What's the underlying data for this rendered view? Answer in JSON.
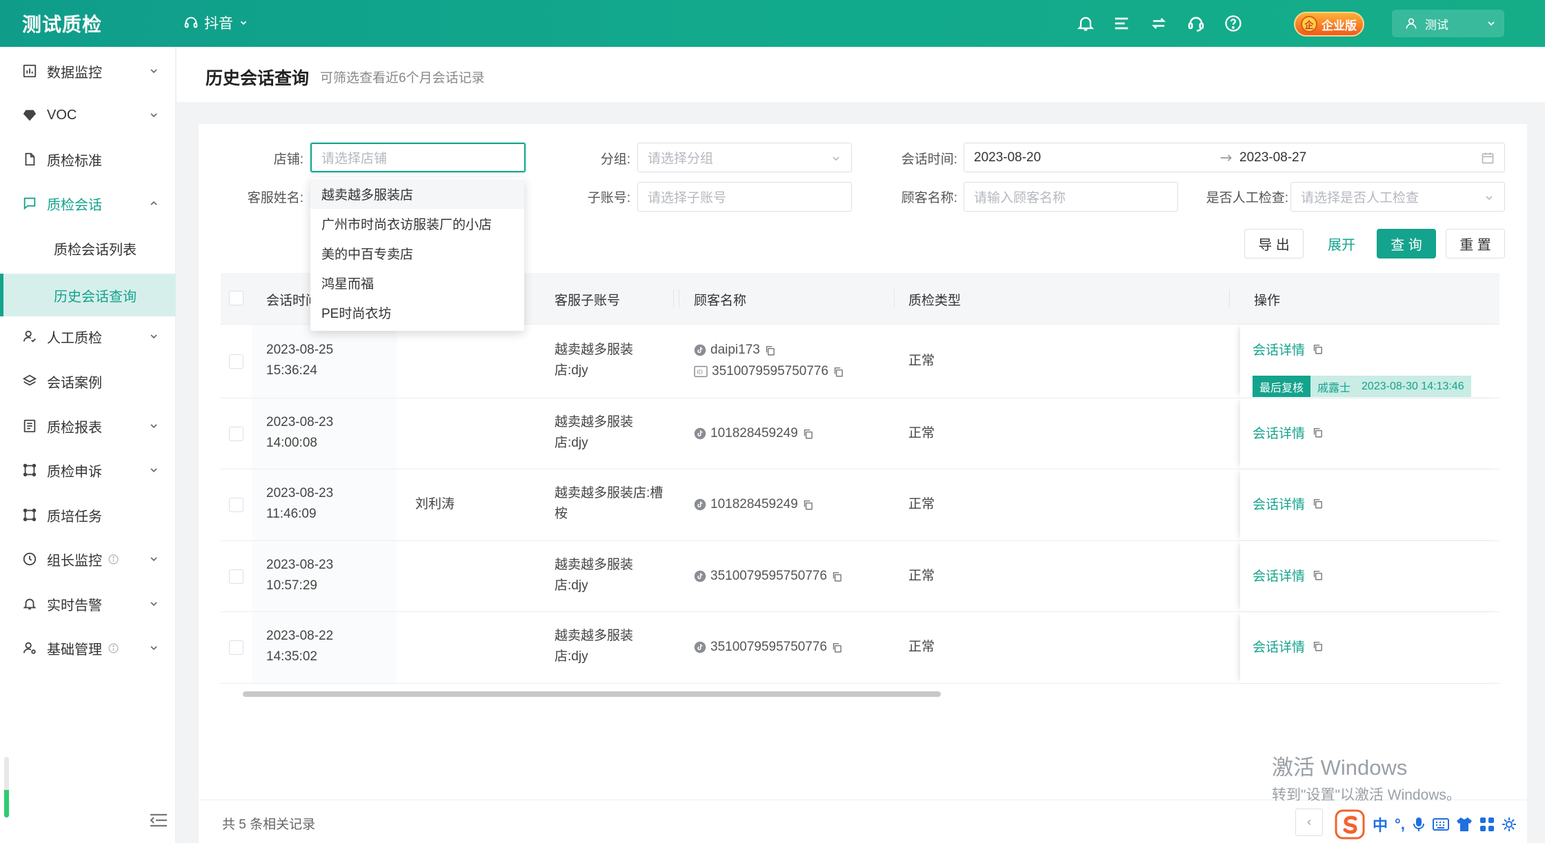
{
  "app": {
    "title": "测试质检",
    "platform": "抖音",
    "edition": "企业版",
    "edition_badge": "企",
    "user": "测试"
  },
  "sidebar": {
    "items": [
      {
        "label": "数据监控",
        "icon": "chart-bar-icon"
      },
      {
        "label": "VOC",
        "icon": "diamond-icon"
      },
      {
        "label": "质检标准",
        "icon": "document-icon"
      },
      {
        "label": "质检会话",
        "icon": "chat-icon"
      },
      {
        "label": "人工质检",
        "icon": "user-check-icon"
      },
      {
        "label": "会话案例",
        "icon": "layers-icon"
      },
      {
        "label": "质检报表",
        "icon": "report-icon"
      },
      {
        "label": "质检申诉",
        "icon": "appeal-icon"
      },
      {
        "label": "质培任务",
        "icon": "task-icon"
      },
      {
        "label": "组长监控",
        "icon": "clock-icon"
      },
      {
        "label": "实时告警",
        "icon": "bell-icon"
      },
      {
        "label": "基础管理",
        "icon": "user-settings-icon"
      }
    ],
    "subitems": [
      "质检会话列表",
      "历史会话查询"
    ],
    "progress_percent": 45
  },
  "page": {
    "title": "历史会话查询",
    "subtitle": "可筛选查看近6个月会话记录"
  },
  "filters": {
    "shop_label": "店铺:",
    "shop_placeholder": "请选择店铺",
    "group_label": "分组:",
    "group_placeholder": "请选择分组",
    "time_label": "会话时间:",
    "time_start": "2023-08-20",
    "time_end": "2023-08-27",
    "agent_label": "客服姓名:",
    "subaccount_label": "子账号:",
    "subaccount_placeholder": "请选择子账号",
    "customer_label": "顾客名称:",
    "customer_placeholder": "请输入顾客名称",
    "manual_label": "是否人工检查:",
    "manual_placeholder": "请选择是否人工检查"
  },
  "buttons": {
    "export": "导 出",
    "expand": "展开",
    "search": "查 询",
    "reset": "重 置"
  },
  "shop_dropdown": [
    "越卖越多服装店",
    "广州市时尚衣访服装厂的小店",
    "美的中百专卖店",
    "鸿星而福",
    "PE时尚衣坊"
  ],
  "table": {
    "columns": [
      "会话时间",
      "客服子账号",
      "顾客名称",
      "质检类型",
      "操作"
    ],
    "rows": [
      {
        "date": "2023-08-25",
        "time": "15:36:24",
        "agent": "",
        "sub1": "越卖越多服装",
        "sub2": "店:djy",
        "cust1": "daipi173",
        "cust2": "3510079595750776",
        "type": "正常",
        "action": "会话详情",
        "review_tag": "最后复核",
        "reviewer": "戚露士",
        "review_time": "2023-08-30 14:13:46"
      },
      {
        "date": "2023-08-23",
        "time": "14:00:08",
        "agent": "",
        "sub1": "越卖越多服装",
        "sub2": "店:djy",
        "cust1": "101828459249",
        "type": "正常",
        "action": "会话详情"
      },
      {
        "date": "2023-08-23",
        "time": "11:46:09",
        "agent": "刘利涛",
        "sub1": "越卖越多服装店:槽",
        "sub2": "桉",
        "cust1": "101828459249",
        "type": "正常",
        "action": "会话详情"
      },
      {
        "date": "2023-08-23",
        "time": "10:57:29",
        "agent": "",
        "sub1": "越卖越多服装",
        "sub2": "店:djy",
        "cust1": "3510079595750776",
        "type": "正常",
        "action": "会话详情"
      },
      {
        "date": "2023-08-22",
        "time": "14:35:02",
        "agent": "",
        "sub1": "越卖越多服装",
        "sub2": "店:djy",
        "cust1": "3510079595750776",
        "type": "正常",
        "action": "会话详情"
      }
    ]
  },
  "footer": {
    "total": "共 5 条相关记录"
  },
  "watermark": {
    "line1": "激活 Windows",
    "line2": "转到\"设置\"以激活 Windows。"
  },
  "ime": {
    "lang": "中",
    "punct": "°,"
  },
  "colors": {
    "brand": "#14a38c",
    "topbar_start": "#0f9d8a",
    "edition_badge": "#f05a1c"
  }
}
